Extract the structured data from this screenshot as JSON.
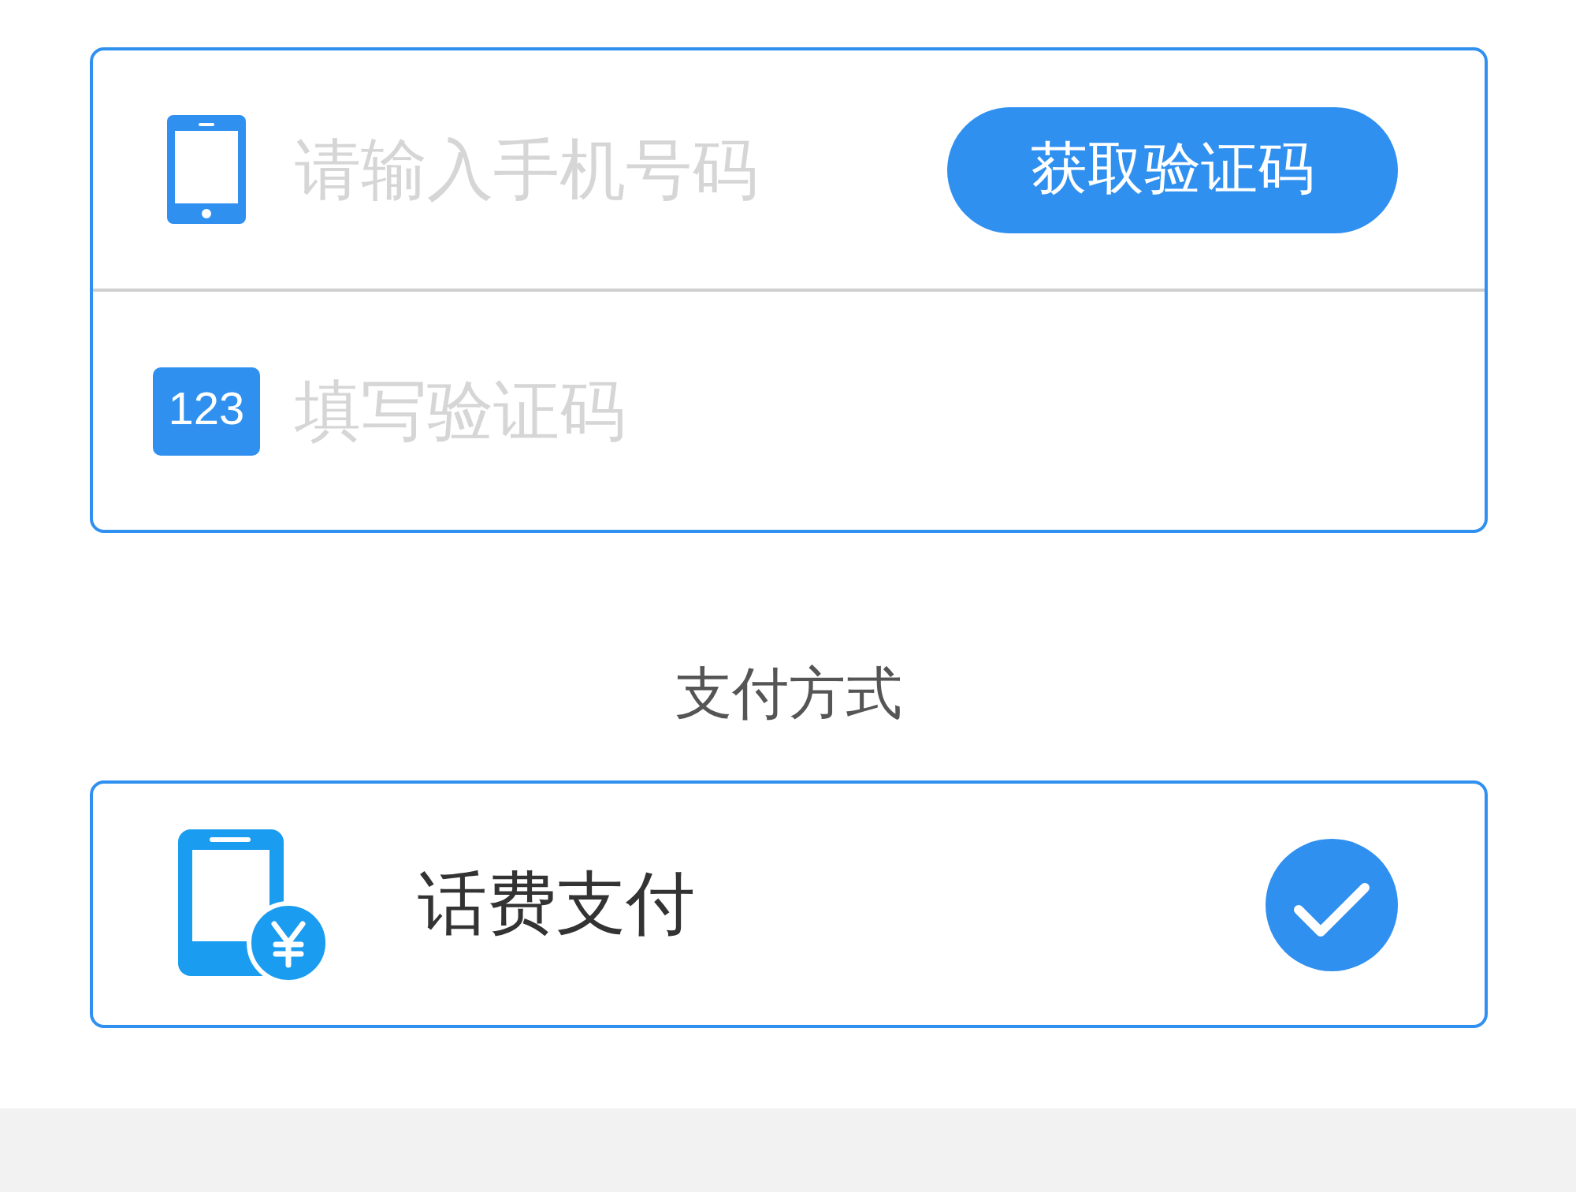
{
  "phone_form": {
    "phone_field": {
      "placeholder": "请输入手机号码"
    },
    "code_button": {
      "label": "获取验证码"
    },
    "code_field": {
      "badge": "123",
      "placeholder": "填写验证码"
    }
  },
  "payment_section": {
    "title": "支付方式",
    "options": [
      {
        "label": "话费支付",
        "selected": true
      }
    ]
  }
}
